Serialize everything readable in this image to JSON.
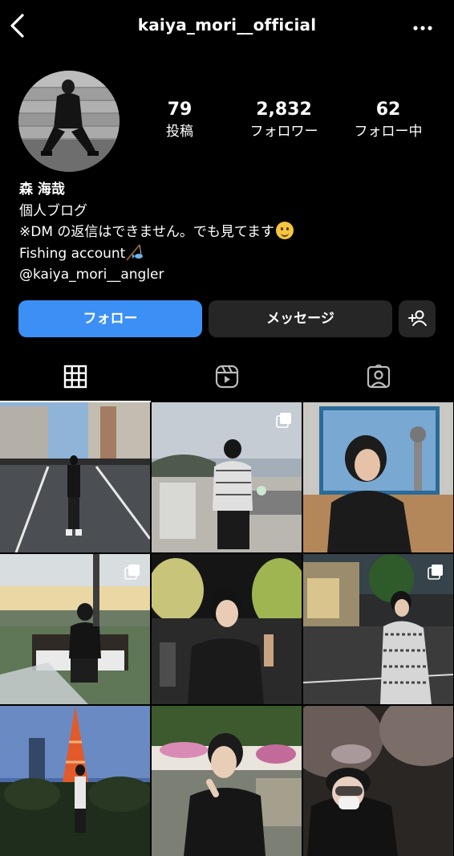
{
  "header": {
    "username": "kaiya_mori__official",
    "back_icon": "chevron-left-icon",
    "more_icon": "more-horizontal-icon"
  },
  "profile": {
    "stats": [
      {
        "value": "79",
        "label": "投稿"
      },
      {
        "value": "2,832",
        "label": "フォロワー"
      },
      {
        "value": "62",
        "label": "フォロー中"
      }
    ],
    "name": "森 海哉",
    "bio_lines": [
      "個人ブログ",
      "※DM の返信はできません。でも見てます",
      "Fishing account",
      "@kaiya_mori__angler"
    ]
  },
  "actions": {
    "follow": "フォロー",
    "message": "メッセージ",
    "add_user_icon": "add-user-icon"
  },
  "tabs": [
    {
      "name": "posts",
      "icon": "grid-icon",
      "active": true
    },
    {
      "name": "reels",
      "icon": "reels-icon",
      "active": false
    },
    {
      "name": "tagged",
      "icon": "tagged-icon",
      "active": false
    }
  ],
  "colors": {
    "background": "#000000",
    "follow_button": "#3c8ff5",
    "secondary_button": "#262626"
  }
}
